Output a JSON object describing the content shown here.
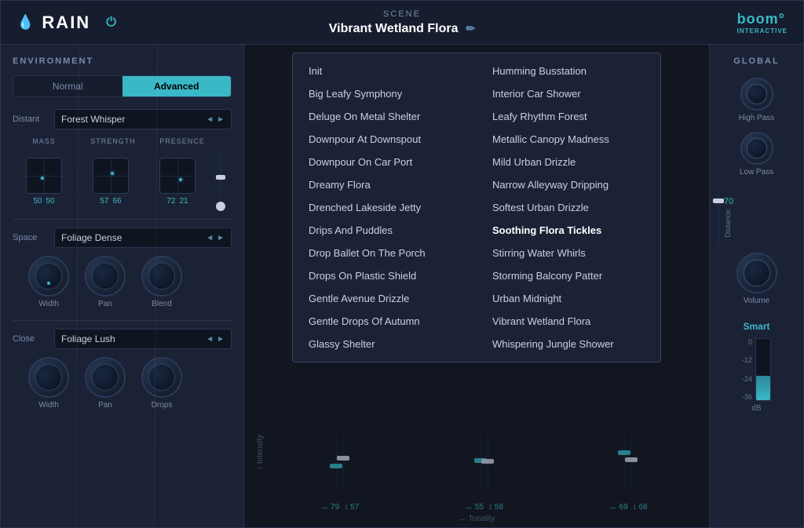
{
  "header": {
    "title": "RAIN",
    "scene_label": "SCENE",
    "scene_name": "Vibrant Wetland Flora",
    "logo": "boom",
    "logo_sub": "INTERACTIVE"
  },
  "left_panel": {
    "title": "ENVIRONMENT",
    "tabs": [
      "Normal",
      "Advanced"
    ],
    "active_tab": "Advanced",
    "distant": {
      "label": "Distant",
      "value": "Forest Whisper"
    },
    "knobs": {
      "mass_label": "MASS",
      "strength_label": "STRENGTH",
      "presence_label": "PRESENCE",
      "mass_val1": "50",
      "mass_val2": "50",
      "strength_val1": "57",
      "strength_val2": "66",
      "presence_val1": "72",
      "presence_val2": "21"
    },
    "space": {
      "label": "Space",
      "value": "Foliage Dense"
    },
    "space_knobs": {
      "width_label": "Width",
      "pan_label": "Pan",
      "blend_label": "Blend"
    },
    "close": {
      "label": "Close",
      "value": "Foliage Lush"
    },
    "close_knobs": {
      "width_label": "Width",
      "pan_label": "Pan",
      "drops_label": "Drops"
    }
  },
  "scene_dropdown": {
    "items_left": [
      "Init",
      "Big Leafy Symphony",
      "Deluge On Metal Shelter",
      "Downpour At Downspout",
      "Downpour On Car Port",
      "Dreamy Flora",
      "Drenched Lakeside Jetty",
      "Drips And Puddles",
      "Drop Ballet On The Porch",
      "Drops On Plastic Shield",
      "Gentle Avenue Drizzle",
      "Gentle Drops Of Autumn",
      "Glassy Shelter"
    ],
    "items_right": [
      "Humming Busstation",
      "Interior Car Shower",
      "Leafy Rhythm Forest",
      "Metallic Canopy Madness",
      "Mild Urban Drizzle",
      "Narrow Alleyway Dripping",
      "Softest Urban Drizzle",
      "Soothing Flora Tickles",
      "Stirring Water Whirls",
      "Storming Balcony Patter",
      "Urban Midnight",
      "Vibrant Wetland Flora",
      "Whispering Jungle Shower"
    ],
    "selected": "Soothing Flora Tickles"
  },
  "intensity": {
    "label": "↕ Intensity",
    "tonality_label": "↔ Tonality",
    "sliders": [
      {
        "h_val": "79",
        "v_val": "57",
        "h_icon": "↔",
        "v_icon": "↕"
      },
      {
        "h_val": "55",
        "v_val": "58",
        "h_icon": "↔",
        "v_icon": "↕"
      },
      {
        "h_val": "69",
        "v_val": "68",
        "h_icon": "↔",
        "v_icon": "↕"
      }
    ]
  },
  "right_panel": {
    "title": "GLOBAL",
    "high_pass_label": "High Pass",
    "low_pass_label": "Low Pass",
    "volume_label": "Volume",
    "smart_label": "Smart",
    "distance_label": "Distance:",
    "distance_val": "70",
    "db_labels": [
      "0",
      "-12",
      "-24",
      "-36"
    ],
    "db_label": "dB"
  }
}
